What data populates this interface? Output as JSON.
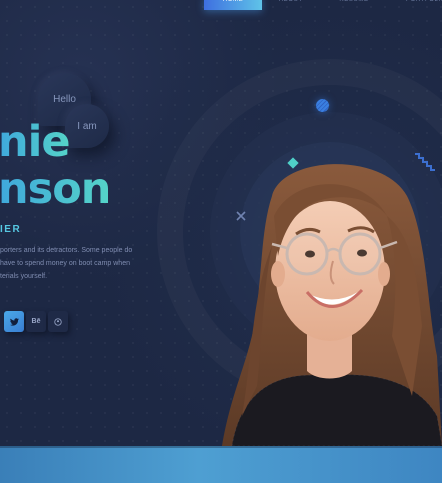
{
  "nav": {
    "items": [
      {
        "label": "HOME",
        "active": true
      },
      {
        "label": "ABOUT",
        "active": false
      },
      {
        "label": "RESUME",
        "active": false
      },
      {
        "label": "PORTFOLIO",
        "active": false
      }
    ]
  },
  "bubbles": {
    "hello": "Hello",
    "iam": "I am"
  },
  "hero": {
    "name_line1": "nie",
    "name_line2": "nson",
    "role": "IER",
    "desc_lines": [
      "porters and its detractors. Some people do",
      "have to spend money on boot camp when",
      "terials yourself."
    ]
  },
  "social": [
    {
      "icon": "twitter-icon",
      "glyph": "🐦"
    },
    {
      "icon": "behance-icon",
      "glyph": "Bē"
    },
    {
      "icon": "github-icon",
      "glyph": "⊙"
    }
  ],
  "colors": {
    "background": "#1d2844",
    "accent": "#55d4c8",
    "accent_blue": "#3fa8dc"
  }
}
